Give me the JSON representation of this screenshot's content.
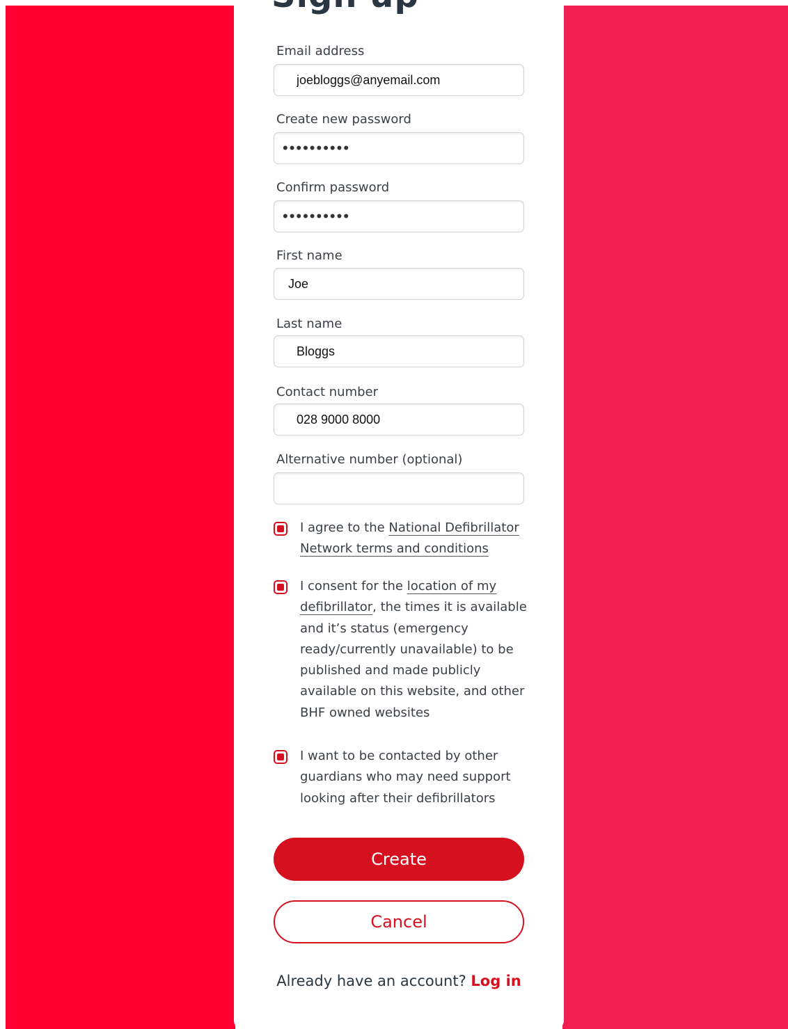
{
  "page": {
    "title": "Sign up"
  },
  "form": {
    "email_label": "Email address",
    "email_value": "joebloggs@anyemail.com",
    "password_label": "Create new password",
    "password_value": "••••••••••",
    "confirm_label": "Confirm password",
    "confirm_value": "••••••••••",
    "first_name_label": "First name",
    "first_name_value": "Joe",
    "last_name_label": "Last name",
    "last_name_value": "Bloggs",
    "contact_label": "Contact number",
    "contact_value": "028 9000 8000",
    "alt_label": "Alternative number (optional)",
    "alt_value": ""
  },
  "checkboxes": {
    "terms_prefix": "I agree to the ",
    "terms_link": "National Defibrillator Network terms and conditions",
    "consent_prefix": "I consent for the ",
    "consent_link": "location of my defibrillator",
    "consent_suffix": ", the times it is available and it’s status (emergency ready/currently unavailable) to be published and made publicly available on this website, and other BHF owned websites",
    "contact_text": "I want to be contacted by other guardians who may need support looking after their defibrillators"
  },
  "actions": {
    "create_label": "Create",
    "cancel_label": "Cancel",
    "login_prompt": "Already have an account?",
    "login_link": "Log in"
  },
  "colors": {
    "bg_left": "#ff0230",
    "bg_right": "#ef1f52",
    "accent": "#d5111f"
  }
}
